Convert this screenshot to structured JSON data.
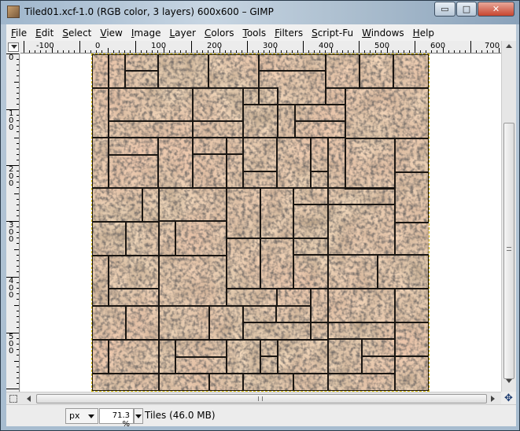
{
  "window": {
    "title": "Tiled01.xcf-1.0 (RGB color, 3 layers) 600x600 – GIMP",
    "minimize_glyph": "▭",
    "maximize_glyph": "□",
    "close_glyph": "✕"
  },
  "menu": [
    "File",
    "Edit",
    "Select",
    "View",
    "Image",
    "Layer",
    "Colors",
    "Tools",
    "Filters",
    "Script-Fu",
    "Windows",
    "Help"
  ],
  "rulers": {
    "horizontal_labels": [
      "-100",
      "0",
      "100",
      "200",
      "300",
      "400",
      "500",
      "600",
      "700"
    ],
    "vertical_labels": [
      "0",
      "100",
      "200",
      "300",
      "400",
      "500"
    ]
  },
  "status": {
    "unit": "px",
    "zoom": "71.3 %",
    "info": "Tiles (46.0 MB)"
  },
  "colors": {
    "title_bar": "#b7c9da",
    "close_button": "#c7452f",
    "selection_border": "#d6b800",
    "stone_base": "#c6a07e",
    "grout": "#1a1612"
  },
  "icons": {
    "app": "gimp-app-icon",
    "navigate": "navigate-icon",
    "quick_mask": "quick-mask-icon"
  }
}
